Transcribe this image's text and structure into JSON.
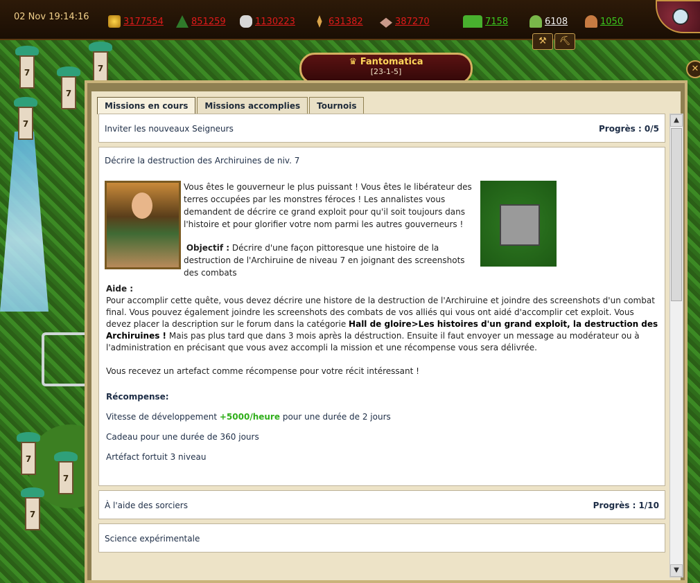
{
  "topbar": {
    "clock": "02 Nov 19:14:16",
    "resources": [
      {
        "icon": "gold-icon",
        "value": "3177554"
      },
      {
        "icon": "wood-icon",
        "value": "851259"
      },
      {
        "icon": "stone-icon",
        "value": "1130223"
      },
      {
        "icon": "grain-icon",
        "value": "631382"
      },
      {
        "icon": "ore-icon",
        "value": "387270"
      }
    ],
    "units": [
      {
        "icon": "army-icon",
        "value": "7158"
      },
      {
        "icon": "knight-icon",
        "value": "6108"
      },
      {
        "icon": "worker-icon",
        "value": "1050"
      }
    ],
    "colors": {
      "resource": "#e01a1a",
      "unit_green": "#3cc81e",
      "unit_white": "#f2f2f2"
    }
  },
  "player": {
    "name": "Fantomatica",
    "coords": "[23-1-5]"
  },
  "tabs": [
    "Missions en cours",
    "Missions accomplies",
    "Tournois"
  ],
  "missions": {
    "first": {
      "title": "Inviter les nouveaux Seigneurs",
      "progress": "Progrès : 0/5"
    },
    "main": {
      "title": "Décrire la destruction des Archiruines de niv. 7",
      "intro": "Vous êtes le gouverneur le plus puissant ! Vous êtes le libérateur des terres occupées par les monstres féroces ! Les annalistes vous demandent de décrire ce grand exploit pour qu'il soit toujours dans l'histoire et pour glorifier votre nom parmi les autres gouverneurs !",
      "objective_label": "Objectif :",
      "objective": "Décrire d'une façon pittoresque une histoire de la destruction de l'Archiruine de niveau 7 en joignant des screenshots des combats",
      "help_label": "Aide :",
      "help_1": "Pour accomplir cette quête, vous devez décrire une histore de la destruction de l'Archiruine et joindre des screenshots d'un combat final. Vous pouvez également joindre les screenshots des combats de vos alliés qui vous ont aidé d'accomplir cet exploit. Vous devez placer la description sur le forum dans la catégorie",
      "help_bold": "Hall de gloire>Les histoires d'un grand exploit, la destruction des Archiruines !",
      "help_2": "Mais pas plus tard que dans 3 mois après la déstruction. Ensuite il faut envoyer un message au modérateur ou à l'administration en précisant que vous avez accompli la mission et une récompense vous sera délivrée.",
      "reward_note": "Vous recevez un artefact comme récompense pour votre récit intéressant !",
      "reward_title": "Récompense:",
      "reward_speed_prefix": "Vitesse de développement",
      "reward_speed_value": "+5000/heure",
      "reward_speed_suffix": "pour une durée de 2 jours",
      "reward_gift": "Cadeau pour une durée de 360 jours",
      "reward_artifact": "Artéfact fortuit 3  niveau"
    },
    "third": {
      "title": "À l'aide des sorciers",
      "progress": "Progrès : 1/10"
    },
    "fourth": {
      "title": "Science expérimentale"
    }
  },
  "map_towers": [
    "7",
    "7",
    "7",
    "7",
    "7",
    "7",
    "7"
  ]
}
